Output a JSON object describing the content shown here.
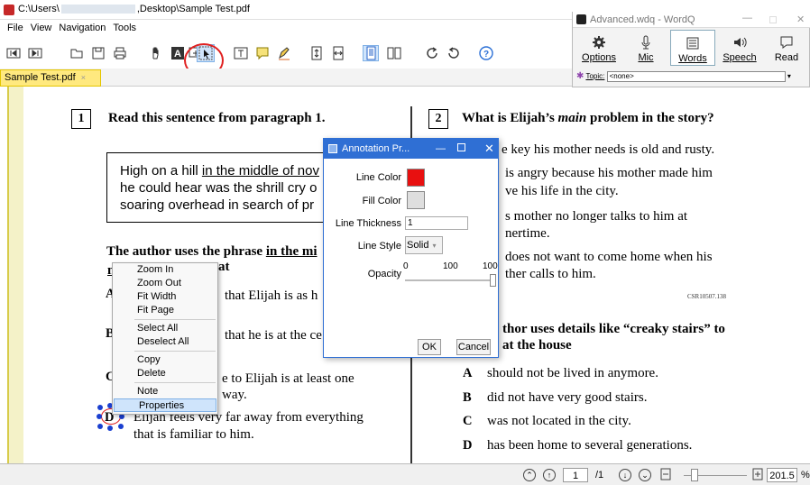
{
  "window": {
    "title_prefix": "C:\\Users\\",
    "title_suffix": ",Desktop\\Sample Test.pdf"
  },
  "menu": [
    "File",
    "View",
    "Navigation",
    "Tools"
  ],
  "tab": {
    "label": "Sample Test.pdf",
    "close": "×"
  },
  "wordq": {
    "title": "Advanced.wdq - WordQ",
    "buttons": [
      {
        "label": "Options",
        "icon": "gear-icon"
      },
      {
        "label": "Mic",
        "icon": "mic-icon"
      },
      {
        "label": "Words",
        "icon": "list-icon"
      },
      {
        "label": "Speech",
        "icon": "speaker-icon"
      },
      {
        "label": "Read",
        "icon": "speech-bubble-icon"
      }
    ],
    "topic_label": "Topic:",
    "topic_value": "<none>"
  },
  "doc": {
    "q1": {
      "number": "1",
      "prompt": "Read this sentence from paragraph 1."
    },
    "passage": {
      "l1a": "High on a hill ",
      "l1u": "in the middle of nov",
      "l2": "he could hear was the shrill cry o",
      "l3": "soaring overhead in search of pr"
    },
    "body_q_a": "The author uses the phrase ",
    "body_q_u": "in the mi",
    "body_q_line2": "at",
    "answers_left": [
      {
        "letter": "A",
        "text": "that Elijah is as h"
      },
      {
        "letter": "B",
        "text": "that he is at the ce"
      },
      {
        "letter": "C",
        "text": "e to Elijah is at least one"
      },
      {
        "letter": "C2",
        "text": "way."
      },
      {
        "letter": "D",
        "text": "Elijah feels very far away from everything"
      },
      {
        "letter": "D2",
        "text": "that is familiar to him."
      }
    ],
    "q2": {
      "number": "2",
      "prompt_a": "What is Elijah’s ",
      "prompt_em": "main",
      "prompt_b": " problem in the story?"
    },
    "right_lines": [
      "e key his mother needs is old and rusty.",
      " is angry because his mother made him",
      "ve his life in the city.",
      "s mother no longer talks to him at",
      "nertime.",
      " does not want to come home when his",
      "ther calls to him."
    ],
    "code_right": "CSR10507.138",
    "q3_l1": "thor uses details like “creaky stairs” to",
    "q3_l2": "at the house",
    "answers_right": [
      {
        "letter": "A",
        "text": "should not be lived in anymore."
      },
      {
        "letter": "B",
        "text": "did not have very good stairs."
      },
      {
        "letter": "C",
        "text": "was not located in the city."
      },
      {
        "letter": "D",
        "text": "has been home to several generations."
      }
    ]
  },
  "context_menu": [
    "Zoom In",
    "Zoom Out",
    "Fit Width",
    "Fit Page",
    "Select All",
    "Deselect All",
    "Copy",
    "Delete",
    "Note",
    "Properties"
  ],
  "dialog": {
    "title": "Annotation Pr...",
    "line_color_label": "Line Color",
    "line_color": "#e81010",
    "fill_color_label": "Fill Color",
    "fill_color": "#dedede",
    "thickness_label": "Line Thickness",
    "thickness_value": "1",
    "style_label": "Line Style",
    "style_value": "Solid",
    "opacity_label": "Opacity",
    "opacity_min": "0",
    "opacity_mid": "100",
    "opacity_max": "100",
    "ok": "OK",
    "cancel": "Cancel"
  },
  "status": {
    "page": "1",
    "total": "/1",
    "zoom": "201.5",
    "zoom_unit": "%"
  }
}
